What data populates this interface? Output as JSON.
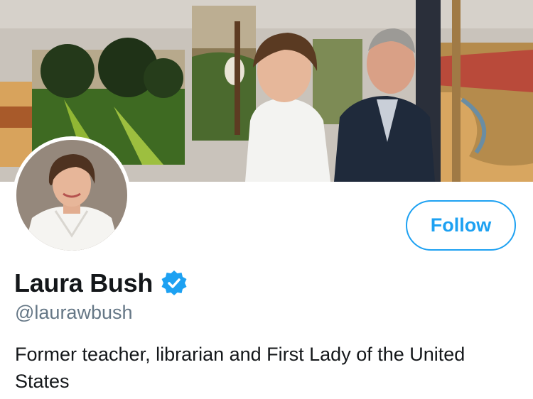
{
  "profile": {
    "display_name": "Laura Bush",
    "handle": "@laurawbush",
    "bio": "Former teacher, librarian and First Lady of the United States",
    "verified": true,
    "verified_icon": "verified-badge-icon"
  },
  "actions": {
    "follow_label": "Follow"
  },
  "colors": {
    "accent": "#1da1f2",
    "handle_text": "#657786",
    "primary_text": "#14171a",
    "background": "#ffffff"
  }
}
